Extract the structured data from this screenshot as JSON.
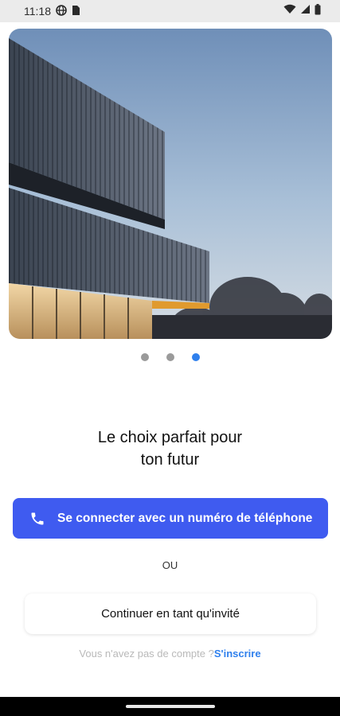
{
  "status_bar": {
    "time": "11:18",
    "icons": [
      "vpn-icon",
      "sim-card-icon",
      "wifi-icon",
      "signal-icon",
      "battery-icon"
    ]
  },
  "hero": {
    "image": "modern-building-photo"
  },
  "pager": {
    "count": 3,
    "active_index": 2
  },
  "headline": {
    "line1": "Le choix parfait pour",
    "line2": "ton futur"
  },
  "phone_login": {
    "label": "Se connecter avec un numéro de téléphone",
    "icon": "phone-icon",
    "color": "#3f5bf0"
  },
  "separator": {
    "label": "OU"
  },
  "guest": {
    "label": "Continuer en tant qu'invité"
  },
  "signup": {
    "question": "Vous n'avez pas de compte ?",
    "link": "S'inscrire",
    "link_color": "#2f80ed"
  }
}
